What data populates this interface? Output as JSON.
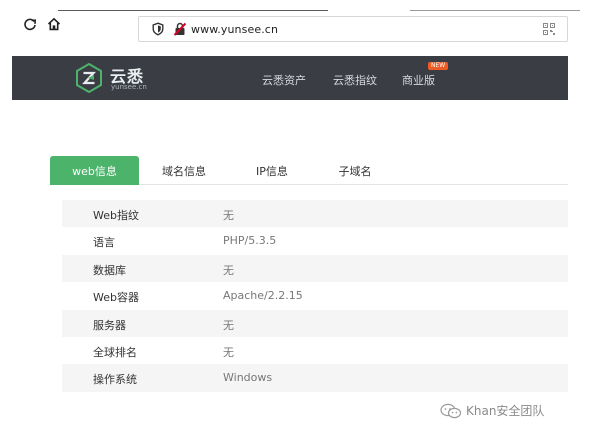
{
  "browser": {
    "url": "www.yunsee.cn",
    "icons": [
      "reload-icon",
      "home-icon",
      "shield-icon",
      "insecure-lock-icon",
      "qr-code-icon"
    ]
  },
  "site": {
    "logo_name": "云悉",
    "logo_domain": "yunsee.cn",
    "nav": {
      "assets": "云悉资产",
      "fingerprint": "云悉指纹",
      "business": "商业版"
    },
    "new_badge": "NEW",
    "header_color": "#3a3d44",
    "accent": "#4cb36b",
    "badge_color": "#ef5b25"
  },
  "tabs": [
    {
      "label": "web信息",
      "active": true
    },
    {
      "label": "域名信息",
      "active": false
    },
    {
      "label": "IP信息",
      "active": false
    },
    {
      "label": "子域名",
      "active": false
    }
  ],
  "info_rows": [
    {
      "key": "Web指纹",
      "value": "无"
    },
    {
      "key": "语言",
      "value": "PHP/5.3.5"
    },
    {
      "key": "数据库",
      "value": "无"
    },
    {
      "key": "Web容器",
      "value": "Apache/2.2.15"
    },
    {
      "key": "服务器",
      "value": "无"
    },
    {
      "key": "全球排名",
      "value": "无"
    },
    {
      "key": "操作系统",
      "value": "Windows"
    }
  ],
  "watermark": {
    "text": "Khan安全团队",
    "icon": "wechat-icon"
  }
}
